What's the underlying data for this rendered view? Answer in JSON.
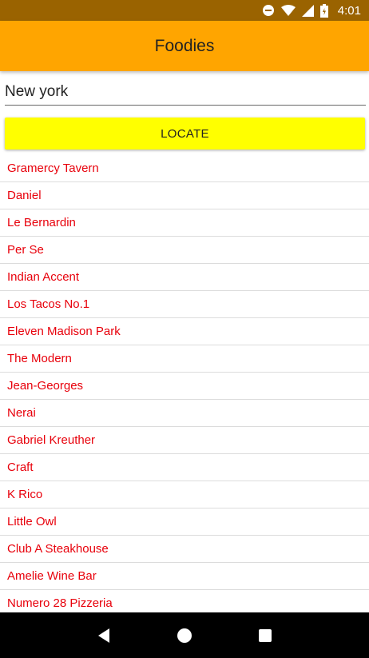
{
  "status_bar": {
    "time": "4:01",
    "icons": [
      "do-not-disturb-icon",
      "wifi-icon",
      "signal-icon",
      "battery-icon"
    ]
  },
  "app_bar": {
    "title": "Foodies"
  },
  "search": {
    "value": "New york"
  },
  "locate_button": {
    "label": "LOCATE"
  },
  "restaurants": [
    "Gramercy Tavern",
    "Daniel",
    "Le Bernardin",
    "Per Se",
    "Indian Accent",
    "Los Tacos No.1",
    "Eleven Madison Park",
    "The Modern",
    "Jean-Georges",
    "Nerai",
    "Gabriel Kreuther",
    "Craft",
    "K Rico",
    "Little Owl",
    "Club A Steakhouse",
    "Amelie Wine Bar",
    "Numero 28 Pizzeria"
  ],
  "colors": {
    "status_bar": "#9a6300",
    "app_bar": "#ffa500",
    "button": "#ffff00",
    "list_text": "#e8000b"
  }
}
